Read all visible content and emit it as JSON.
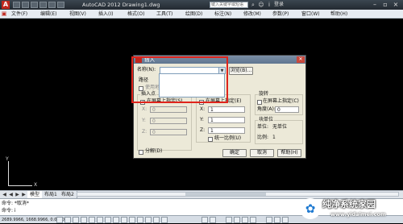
{
  "app": {
    "logo_letter": "A",
    "title": "AutoCAD 2012    Drawing1.dwg",
    "search_placeholder": "键入关键字或短语",
    "login": "登录",
    "window_buttons": [
      "–",
      "▫",
      "×"
    ]
  },
  "menu": {
    "items": [
      "文件(F)",
      "编辑(E)",
      "视图(V)",
      "插入(I)",
      "格式(O)",
      "工具(T)",
      "绘图(D)",
      "标注(N)",
      "修改(M)",
      "参数(P)",
      "窗口(W)",
      "帮助(H)"
    ]
  },
  "ucs": {
    "y": "Y",
    "x": "X"
  },
  "tabs": {
    "nav": [
      "◀",
      "◀",
      "▶",
      "▶"
    ],
    "items": [
      "模型",
      "布局1",
      "布局2"
    ]
  },
  "command": {
    "lines": [
      "命令: *取消*",
      "命令: i"
    ]
  },
  "status": {
    "coords": "2689.9966, 1668.9966, 0.0000"
  },
  "dialog": {
    "title": "插入",
    "name_label": "名称(N):",
    "name_value": "",
    "browse_label": "浏览(B)...",
    "path_label": "路径",
    "geo_label": "使用地理数据进行定位(G)",
    "insertion_point": {
      "title": "插入点",
      "onscreen_label": "在屏幕上指定(S)",
      "onscreen_checked": true,
      "x_label": "X:",
      "x_value": "0",
      "y_label": "Y:",
      "y_value": "0",
      "z_label": "Z:",
      "z_value": "0"
    },
    "scale": {
      "title": "比例",
      "onscreen_label": "在屏幕上指定(E)",
      "onscreen_checked": false,
      "x_label": "X:",
      "x_value": "1",
      "y_label": "Y:",
      "y_value": "1",
      "z_label": "Z:",
      "z_value": "1",
      "uniform_label": "统一比例(U)",
      "uniform_checked": false
    },
    "rotation": {
      "title": "旋转",
      "onscreen_label": "在屏幕上指定(C)",
      "onscreen_checked": false,
      "angle_label": "角度(A):",
      "angle_value": "0"
    },
    "block_unit": {
      "title": "块单位",
      "unit_label": "单位:",
      "unit_value": "无单位",
      "factor_label": "比例:",
      "factor_value": "1"
    },
    "explode_label": "分解(D)",
    "explode_checked": false,
    "ok_label": "确定",
    "cancel_label": "取消",
    "help_label": "帮助(H)"
  },
  "watermark": {
    "text": "纯净系统家园",
    "url": "www.yidaimei.com"
  }
}
